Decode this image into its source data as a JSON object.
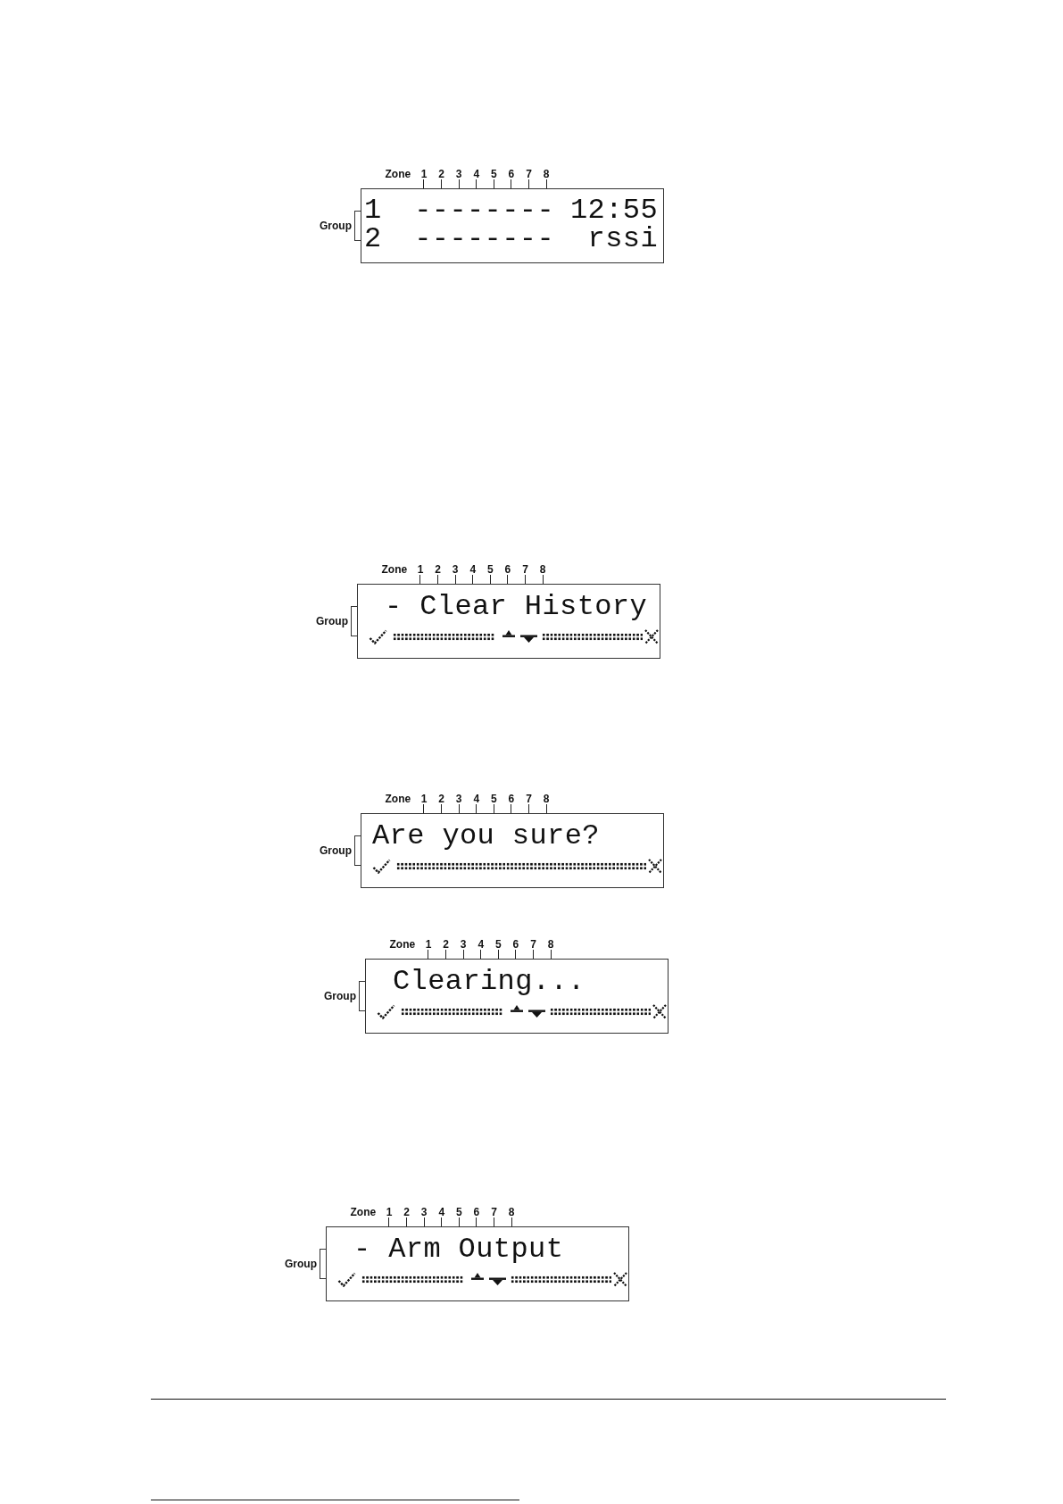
{
  "displays": [
    {
      "kind": "status",
      "zone_label": "Zone",
      "zones": [
        "1",
        "2",
        "3",
        "4",
        "5",
        "6",
        "7",
        "8"
      ],
      "group_label": "Group",
      "rows": [
        {
          "group": "1",
          "zones": "--------",
          "info": "12:55"
        },
        {
          "group": "2",
          "zones": "--------",
          "info": "rssi"
        }
      ]
    },
    {
      "kind": "menu",
      "zone_label": "Zone",
      "zones": [
        "1",
        "2",
        "3",
        "4",
        "5",
        "6",
        "7",
        "8"
      ],
      "group_label": "Group",
      "text": "- Clear History",
      "scroll_arrows": true
    },
    {
      "kind": "prompt",
      "zone_label": "Zone",
      "zones": [
        "1",
        "2",
        "3",
        "4",
        "5",
        "6",
        "7",
        "8"
      ],
      "group_label": "Group",
      "text": "Are you sure?",
      "scroll_arrows": false
    },
    {
      "kind": "message",
      "zone_label": "Zone",
      "zones": [
        "1",
        "2",
        "3",
        "4",
        "5",
        "6",
        "7",
        "8"
      ],
      "group_label": "Group",
      "text": "Clearing...",
      "scroll_arrows": true
    },
    {
      "kind": "menu",
      "zone_label": "Zone",
      "zones": [
        "1",
        "2",
        "3",
        "4",
        "5",
        "6",
        "7",
        "8"
      ],
      "group_label": "Group",
      "text": "- Arm Output",
      "scroll_arrows": true
    }
  ]
}
